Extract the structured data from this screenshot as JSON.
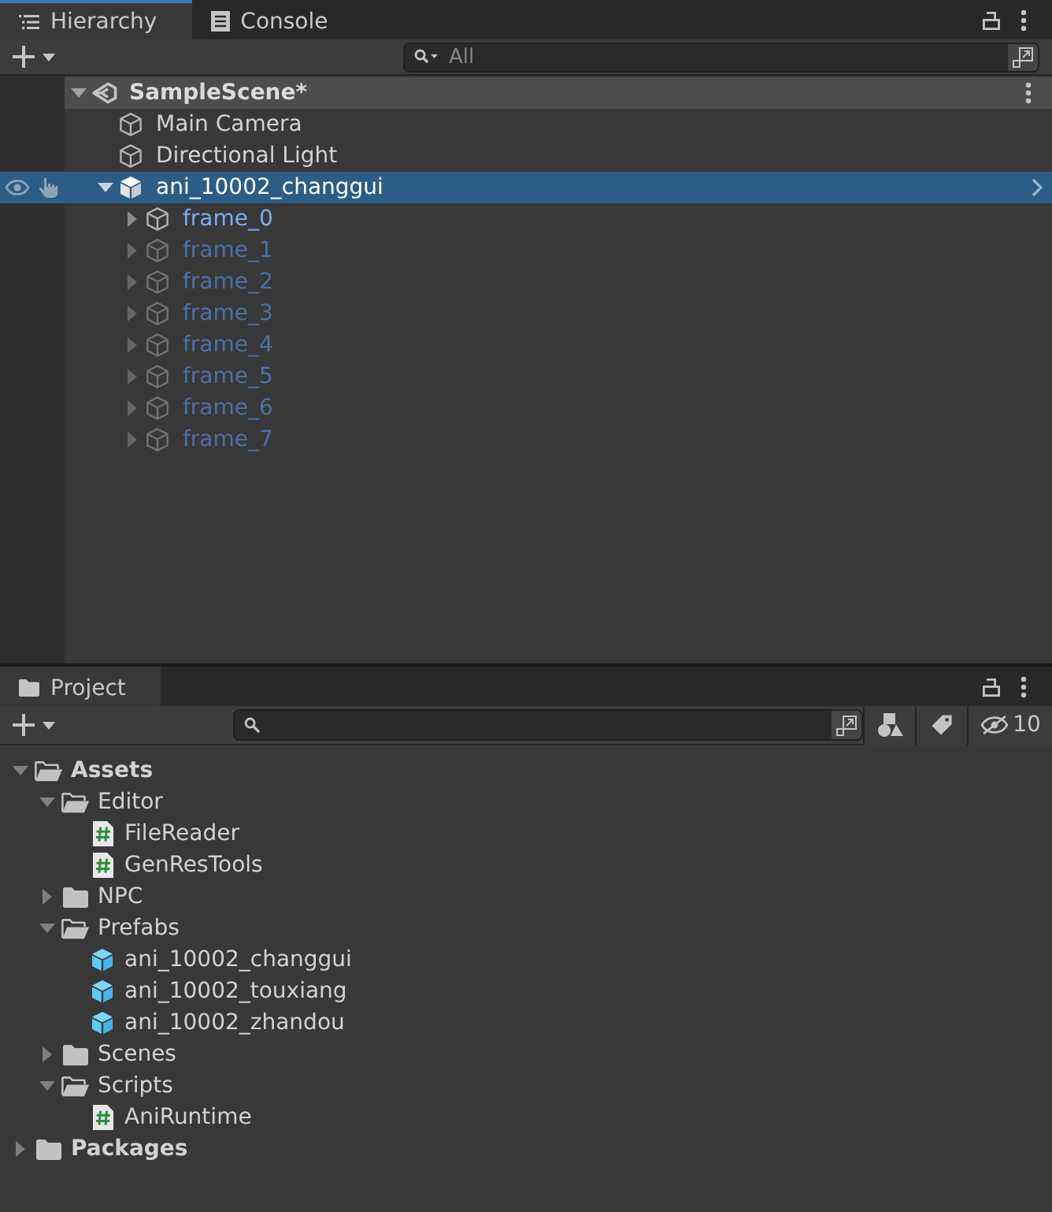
{
  "hierarchy_panel": {
    "focused": true,
    "tabs": [
      {
        "label": "Hierarchy",
        "kind": "list",
        "selected": true
      },
      {
        "label": "Console",
        "kind": "console",
        "selected": false
      }
    ],
    "search": {
      "placeholder": "All"
    },
    "scene": {
      "name": "SampleScene*",
      "expanded": true,
      "children": [
        {
          "name": "Main Camera",
          "kind": "object",
          "selected": false,
          "active": true
        },
        {
          "name": "Directional Light",
          "kind": "object",
          "selected": false,
          "active": true
        },
        {
          "name": "ani_10002_changgui",
          "kind": "prefab",
          "selected": true,
          "active": true,
          "expanded": true,
          "children": [
            {
              "name": "frame_0",
              "kind": "prefab_part",
              "selected": false,
              "active": true,
              "expanded": false
            },
            {
              "name": "frame_1",
              "kind": "prefab_part",
              "selected": false,
              "active": false,
              "expanded": false
            },
            {
              "name": "frame_2",
              "kind": "prefab_part",
              "selected": false,
              "active": false,
              "expanded": false
            },
            {
              "name": "frame_3",
              "kind": "prefab_part",
              "selected": false,
              "active": false,
              "expanded": false
            },
            {
              "name": "frame_4",
              "kind": "prefab_part",
              "selected": false,
              "active": false,
              "expanded": false
            },
            {
              "name": "frame_5",
              "kind": "prefab_part",
              "selected": false,
              "active": false,
              "expanded": false
            },
            {
              "name": "frame_6",
              "kind": "prefab_part",
              "selected": false,
              "active": false,
              "expanded": false
            },
            {
              "name": "frame_7",
              "kind": "prefab_part",
              "selected": false,
              "active": false,
              "expanded": false
            }
          ]
        }
      ]
    }
  },
  "project_panel": {
    "focused": false,
    "tabs": [
      {
        "label": "Project",
        "kind": "folder",
        "selected": true
      }
    ],
    "hidden_count": "10",
    "tree": [
      {
        "name": "Assets",
        "kind": "folder",
        "expanded": true,
        "children": [
          {
            "name": "Editor",
            "kind": "folder",
            "expanded": true,
            "children": [
              {
                "name": "FileReader",
                "kind": "script"
              },
              {
                "name": "GenResTools",
                "kind": "script"
              }
            ]
          },
          {
            "name": "NPC",
            "kind": "folder",
            "expanded": false
          },
          {
            "name": "Prefabs",
            "kind": "folder",
            "expanded": true,
            "children": [
              {
                "name": "ani_10002_changgui",
                "kind": "prefab"
              },
              {
                "name": "ani_10002_touxiang",
                "kind": "prefab"
              },
              {
                "name": "ani_10002_zhandou",
                "kind": "prefab"
              }
            ]
          },
          {
            "name": "Scenes",
            "kind": "folder",
            "expanded": false
          },
          {
            "name": "Scripts",
            "kind": "folder",
            "expanded": true,
            "children": [
              {
                "name": "AniRuntime",
                "kind": "script"
              }
            ]
          }
        ]
      },
      {
        "name": "Packages",
        "kind": "folder",
        "expanded": false
      }
    ]
  }
}
